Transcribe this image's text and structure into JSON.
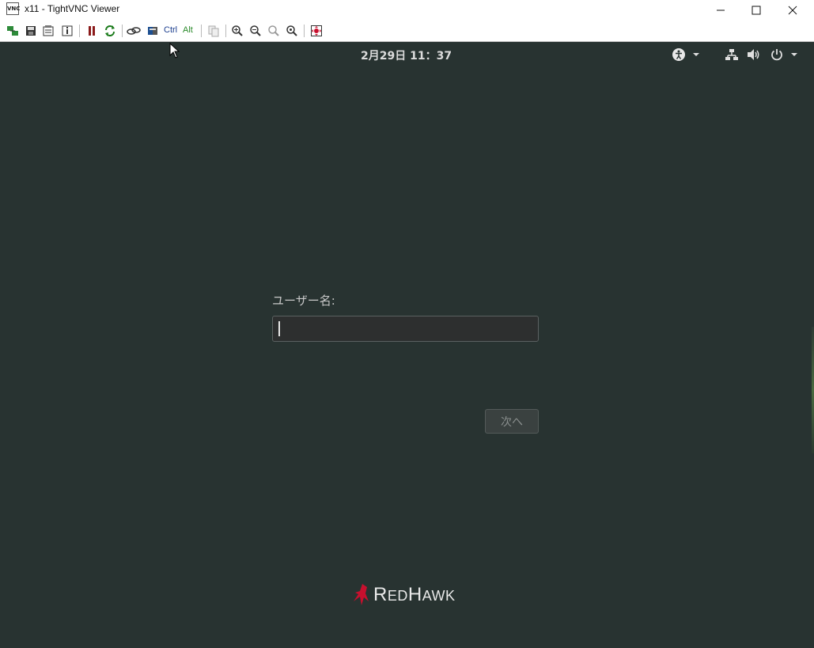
{
  "window": {
    "title": "x11 - TightVNC Viewer",
    "app_icon_label": "VNC"
  },
  "toolbar": {
    "ctrl_label": "Ctrl",
    "alt_label": "Alt"
  },
  "remote": {
    "topbar": {
      "clock": "2月29日  11：37"
    },
    "login": {
      "username_label": "ユーザー名:",
      "username_value": "",
      "next_button": "次へ"
    },
    "brand": {
      "initial_r": "R",
      "ed": "ED",
      "initial_h": "H",
      "awk": "AWK"
    }
  },
  "colors": {
    "desktop_bg": "#283331",
    "brand_red": "#c8102e"
  }
}
